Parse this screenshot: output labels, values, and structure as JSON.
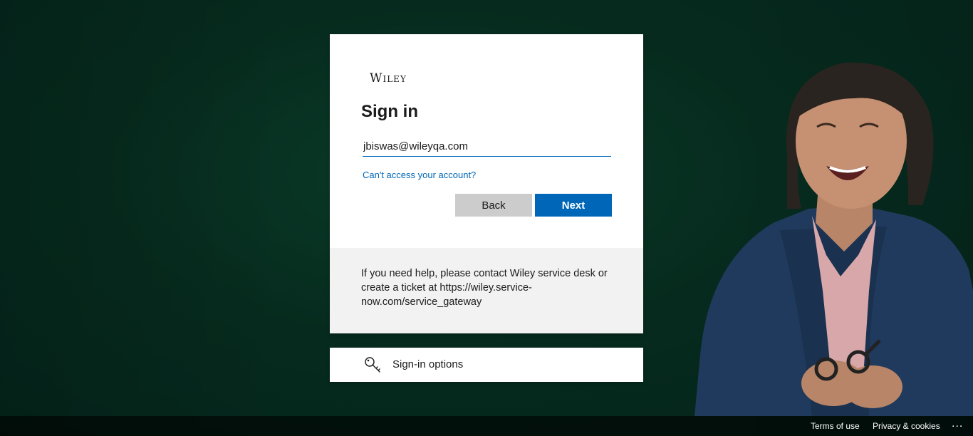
{
  "brand": {
    "logo_text": "Wiley"
  },
  "signin": {
    "title": "Sign in",
    "email_value": "jbiswas@wileyqa.com",
    "cant_access_link": "Can't access your account?",
    "back_label": "Back",
    "next_label": "Next"
  },
  "help": {
    "text": "If you need help, please contact Wiley service desk or create a ticket at https://wiley.service-now.com/service_gateway"
  },
  "options": {
    "label": "Sign-in options",
    "icon": "key-icon"
  },
  "footer": {
    "terms": "Terms of use",
    "privacy": "Privacy & cookies",
    "more": "..."
  },
  "colors": {
    "accent": "#0067b8",
    "background": "#062b1e",
    "back_button": "#cccccc"
  }
}
